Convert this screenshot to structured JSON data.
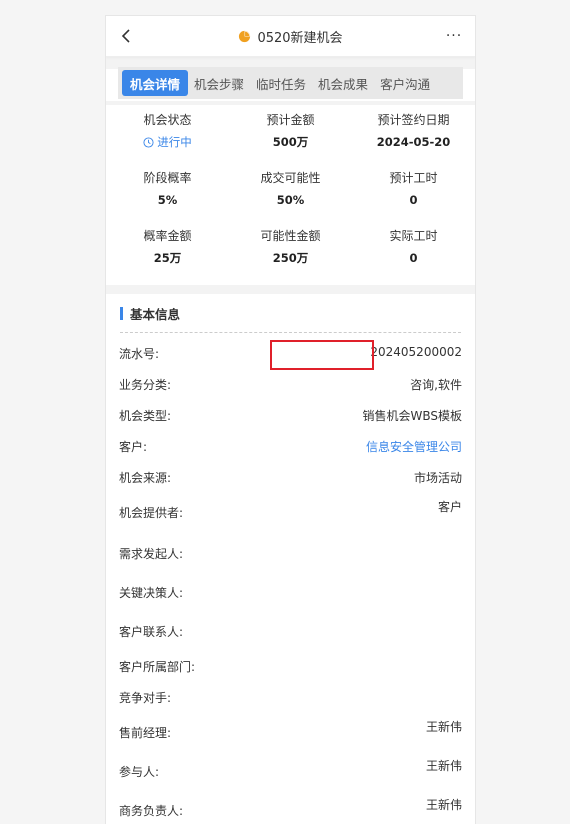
{
  "header": {
    "title": "0520新建机会",
    "more_label": "···",
    "pie_color": "#f0a020"
  },
  "tabs": [
    {
      "label": "机会详情",
      "active": true
    },
    {
      "label": "机会步骤"
    },
    {
      "label": "临时任务"
    },
    {
      "label": "机会成果"
    },
    {
      "label": "客户沟通"
    }
  ],
  "stats": [
    [
      {
        "label": "机会状态",
        "value": "进行中",
        "icon": "clock-icon"
      },
      {
        "label": "预计金额",
        "value": "500万"
      },
      {
        "label": "预计签约日期",
        "value": "2024-05-20"
      }
    ],
    [
      {
        "label": "阶段概率",
        "value": "5%"
      },
      {
        "label": "成交可能性",
        "value": "50%"
      },
      {
        "label": "预计工时",
        "value": "0"
      }
    ],
    [
      {
        "label": "概率金额",
        "value": "25万"
      },
      {
        "label": "可能性金额",
        "value": "250万"
      },
      {
        "label": "实际工时",
        "value": "0"
      }
    ]
  ],
  "section": {
    "title": "基本信息"
  },
  "fields": [
    {
      "key": "流水号:",
      "value": "202405200002"
    },
    {
      "key": "业务分类:",
      "value": "咨询,软件"
    },
    {
      "key": "机会类型:",
      "value": "销售机会WBS模板"
    },
    {
      "key": "客户:",
      "value": "信息安全管理公司",
      "link": true
    },
    {
      "key": "机会来源:",
      "value": "市场活动"
    },
    {
      "key": "机会提供者:",
      "value": "客户"
    },
    {
      "key": "需求发起人:",
      "value": ""
    },
    {
      "key": "关键决策人:",
      "value": ""
    },
    {
      "key": "客户联系人:",
      "value": ""
    },
    {
      "key": "客户所属部门:",
      "value": ""
    },
    {
      "key": "竞争对手:",
      "value": ""
    },
    {
      "key": "售前经理:",
      "value": "王新伟"
    },
    {
      "key": "参与人:",
      "value": "王新伟"
    },
    {
      "key": "商务负责人:",
      "value": "王新伟"
    }
  ],
  "colors": {
    "accent": "#3a86e8",
    "highlight": "#e0202a"
  }
}
